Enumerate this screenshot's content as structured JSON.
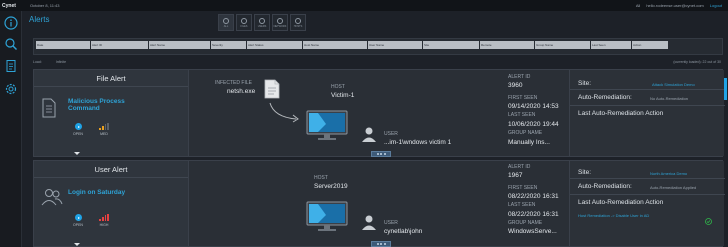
{
  "topbar": {
    "brand": "Cynet",
    "date": "October 8, 11:43",
    "notifications": "All",
    "user": "hello.rodeense.user@cynet.com",
    "logout": "Logout"
  },
  "sidebar": {
    "items": [
      {
        "icon": "info-icon"
      },
      {
        "icon": "search-icon"
      },
      {
        "icon": "report-icon"
      },
      {
        "icon": "settings-icon"
      }
    ]
  },
  "page": {
    "title": "Alerts"
  },
  "view_tabs": [
    {
      "label": "ALL"
    },
    {
      "label": "FILES"
    },
    {
      "label": "USERS"
    },
    {
      "label": "NETWORK"
    },
    {
      "label": "HOSTS"
    }
  ],
  "filters": {
    "columns": [
      "Date",
      "Alert ID",
      "Alert Name",
      "Severity",
      "Alert Status",
      "Host Name",
      "User Name",
      "Site",
      "Remote",
      "Group Name",
      "Last Seen",
      "Action"
    ]
  },
  "list_bar": {
    "load_label": "Load:",
    "mode": "Infinite",
    "count": "(currently loaded): 22 out of 30"
  },
  "alerts": [
    {
      "kind": "File Alert",
      "name_line1": "Malicious Process",
      "name_line2": "Command",
      "status": "OPEN",
      "severity": "MED",
      "infected_file_label": "INFECTED FILE",
      "infected_file": "netsh.exe",
      "host_label": "HOST",
      "host": "Victim-1",
      "user_label": "USER",
      "user": "...im-1\\wndows victim 1",
      "alert_id_label": "ALERT ID",
      "alert_id": "3960",
      "first_seen_label": "FIRST SEEN",
      "first_seen": "09/14/2020 14:53",
      "last_seen_label": "LAST SEEN",
      "last_seen": "10/06/2020 19:44",
      "group_label": "GROUP NAME",
      "group": "Manually Ins...",
      "site_label": "Site:",
      "site": "Attack Simulation Demo",
      "auto_label": "Auto-Remediation:",
      "auto_value": "No Auto-Remediation",
      "last_action_label": "Last Auto-Remediation Action",
      "last_action": ""
    },
    {
      "kind": "User Alert",
      "name_line1": "Login on Saturday",
      "name_line2": "",
      "status": "OPEN",
      "severity": "HIGH",
      "host_label": "HOST",
      "host": "Server2019",
      "user_label": "USER",
      "user": "cynetlab\\john",
      "alert_id_label": "ALERT ID",
      "alert_id": "1967",
      "first_seen_label": "FIRST SEEN",
      "first_seen": "08/22/2020 16:31",
      "last_seen_label": "LAST SEEN",
      "last_seen": "08/22/2020 16:31",
      "group_label": "GROUP NAME",
      "group": "WindowsServe...",
      "site_label": "Site:",
      "site": "North America Demo",
      "auto_label": "Auto-Remediation:",
      "auto_value": "Auto-Remediation Applied",
      "last_action_label": "Last Auto-Remediation Action",
      "last_action": "Host Remediation -> Disable User in AD"
    }
  ],
  "colors": {
    "accent": "#2ea3d6",
    "open": "#1fa3e6",
    "med": "#e8a020",
    "high": "#e84040",
    "success": "#2fb84a"
  }
}
